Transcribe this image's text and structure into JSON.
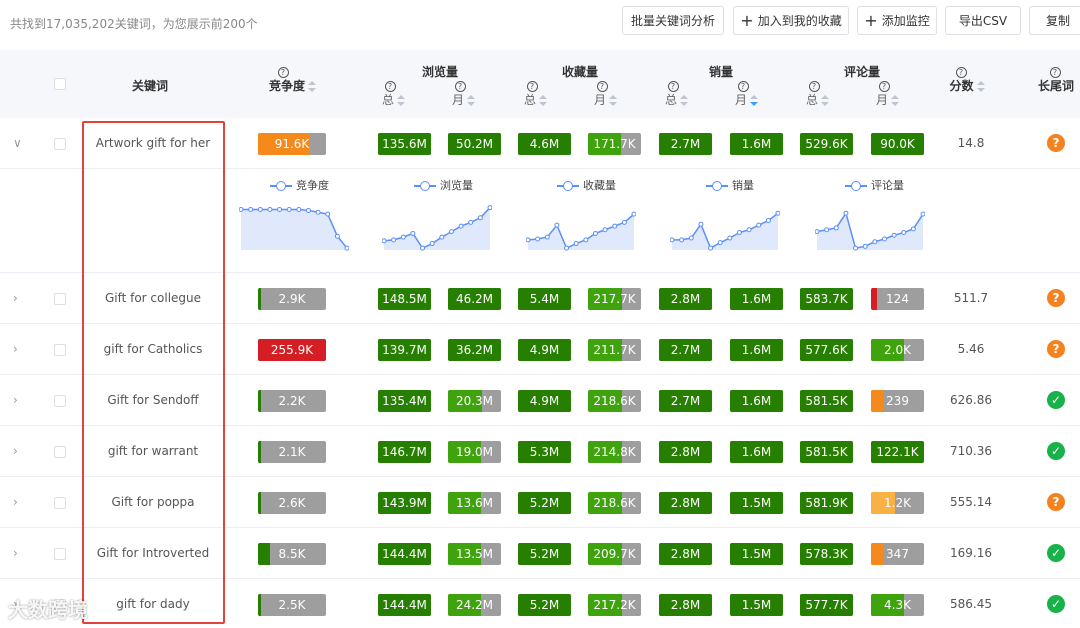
{
  "topbar": {
    "result_text": "共找到17,035,202关键词，为您展示前200个",
    "buttons": [
      "批量关键词分析",
      "加入到我的收藏",
      "添加监控",
      "导出CSV",
      "复制"
    ]
  },
  "header": {
    "keyword": "关键词",
    "competition": "竞争度",
    "views": "浏览量",
    "favorites": "收藏量",
    "sales": "销量",
    "reviews": "评论量",
    "score": "分数",
    "longtail": "长尾词",
    "total": "总",
    "month": "月"
  },
  "colors": {
    "dark_green": "#267f00",
    "mid_green": "#3fa30e",
    "orange": "#f5891b",
    "light_orange": "#f9b144",
    "red": "#d51e24",
    "grey": "#9e9e9e",
    "chart_line": "#5b8ff9",
    "check_green": "#19b24a",
    "question_orange": "#f5811f"
  },
  "expanded_charts": {
    "legends": [
      "竞争度",
      "浏览量",
      "收藏量",
      "销量",
      "评论量"
    ],
    "series": [
      [
        88,
        88,
        88,
        88,
        88,
        88,
        88,
        86,
        82,
        78,
        30,
        4
      ],
      [
        20,
        22,
        28,
        36,
        4,
        14,
        28,
        40,
        52,
        60,
        70,
        92
      ],
      [
        22,
        24,
        28,
        54,
        4,
        14,
        22,
        36,
        44,
        52,
        60,
        78
      ],
      [
        22,
        22,
        26,
        56,
        4,
        16,
        26,
        38,
        44,
        54,
        64,
        80
      ],
      [
        40,
        44,
        48,
        80,
        4,
        8,
        18,
        24,
        32,
        38,
        46,
        78
      ]
    ]
  },
  "rows": [
    {
      "keyword": "Artwork gift for her",
      "expanded": true,
      "comp": {
        "text": "91.6K",
        "color": "orange",
        "fill": 0.75
      },
      "cells": [
        {
          "text": "135.6M",
          "color": "dark_green",
          "fill": 1
        },
        {
          "text": "50.2M",
          "color": "dark_green",
          "fill": 1
        },
        {
          "text": "4.6M",
          "color": "dark_green",
          "fill": 1
        },
        {
          "text": "171.7K",
          "color": "mid_green",
          "fill": 0.62
        },
        {
          "text": "2.7M",
          "color": "dark_green",
          "fill": 1
        },
        {
          "text": "1.6M",
          "color": "dark_green",
          "fill": 1
        },
        {
          "text": "529.6K",
          "color": "dark_green",
          "fill": 1
        },
        {
          "text": "90.0K",
          "color": "dark_green",
          "fill": 1
        }
      ],
      "score": "14.8",
      "longtail": "question"
    },
    {
      "keyword": "Gift for collegue",
      "expanded": false,
      "comp": {
        "text": "2.9K",
        "color": "dark_green",
        "fill": 0.05
      },
      "cells": [
        {
          "text": "148.5M",
          "color": "dark_green",
          "fill": 1
        },
        {
          "text": "46.2M",
          "color": "dark_green",
          "fill": 1
        },
        {
          "text": "5.4M",
          "color": "dark_green",
          "fill": 1
        },
        {
          "text": "217.7K",
          "color": "mid_green",
          "fill": 0.65
        },
        {
          "text": "2.8M",
          "color": "dark_green",
          "fill": 1
        },
        {
          "text": "1.6M",
          "color": "dark_green",
          "fill": 1
        },
        {
          "text": "583.7K",
          "color": "dark_green",
          "fill": 1
        },
        {
          "text": "124",
          "color": "red",
          "fill": 0.12
        }
      ],
      "score": "511.7",
      "longtail": "question"
    },
    {
      "keyword": "gift for Catholics",
      "expanded": false,
      "comp": {
        "text": "255.9K",
        "color": "red",
        "fill": 1
      },
      "cells": [
        {
          "text": "139.7M",
          "color": "dark_green",
          "fill": 1
        },
        {
          "text": "36.2M",
          "color": "dark_green",
          "fill": 1
        },
        {
          "text": "4.9M",
          "color": "dark_green",
          "fill": 1
        },
        {
          "text": "211.7K",
          "color": "mid_green",
          "fill": 0.65
        },
        {
          "text": "2.7M",
          "color": "dark_green",
          "fill": 1
        },
        {
          "text": "1.6M",
          "color": "dark_green",
          "fill": 1
        },
        {
          "text": "577.6K",
          "color": "dark_green",
          "fill": 1
        },
        {
          "text": "2.0K",
          "color": "mid_green",
          "fill": 0.62
        }
      ],
      "score": "5.46",
      "longtail": "question"
    },
    {
      "keyword": "Gift for Sendoff",
      "expanded": false,
      "comp": {
        "text": "2.2K",
        "color": "dark_green",
        "fill": 0.05
      },
      "cells": [
        {
          "text": "135.4M",
          "color": "dark_green",
          "fill": 1
        },
        {
          "text": "20.3M",
          "color": "mid_green",
          "fill": 0.65
        },
        {
          "text": "4.9M",
          "color": "dark_green",
          "fill": 1
        },
        {
          "text": "218.6K",
          "color": "mid_green",
          "fill": 0.65
        },
        {
          "text": "2.7M",
          "color": "dark_green",
          "fill": 1
        },
        {
          "text": "1.6M",
          "color": "dark_green",
          "fill": 1
        },
        {
          "text": "581.5K",
          "color": "dark_green",
          "fill": 1
        },
        {
          "text": "239",
          "color": "orange",
          "fill": 0.22
        }
      ],
      "score": "626.86",
      "longtail": "check"
    },
    {
      "keyword": "gift for warrant",
      "expanded": false,
      "comp": {
        "text": "2.1K",
        "color": "dark_green",
        "fill": 0.05
      },
      "cells": [
        {
          "text": "146.7M",
          "color": "dark_green",
          "fill": 1
        },
        {
          "text": "19.0M",
          "color": "mid_green",
          "fill": 0.62
        },
        {
          "text": "5.3M",
          "color": "dark_green",
          "fill": 1
        },
        {
          "text": "214.8K",
          "color": "mid_green",
          "fill": 0.65
        },
        {
          "text": "2.8M",
          "color": "dark_green",
          "fill": 1
        },
        {
          "text": "1.6M",
          "color": "dark_green",
          "fill": 1
        },
        {
          "text": "581.5K",
          "color": "dark_green",
          "fill": 1
        },
        {
          "text": "122.1K",
          "color": "dark_green",
          "fill": 1
        }
      ],
      "score": "710.36",
      "longtail": "check"
    },
    {
      "keyword": "Gift for poppa",
      "expanded": false,
      "comp": {
        "text": "2.6K",
        "color": "dark_green",
        "fill": 0.05
      },
      "cells": [
        {
          "text": "143.9M",
          "color": "dark_green",
          "fill": 1
        },
        {
          "text": "13.6M",
          "color": "mid_green",
          "fill": 0.62
        },
        {
          "text": "5.2M",
          "color": "dark_green",
          "fill": 1
        },
        {
          "text": "218.6K",
          "color": "mid_green",
          "fill": 0.65
        },
        {
          "text": "2.8M",
          "color": "dark_green",
          "fill": 1
        },
        {
          "text": "1.5M",
          "color": "dark_green",
          "fill": 1
        },
        {
          "text": "581.9K",
          "color": "dark_green",
          "fill": 1
        },
        {
          "text": "1.2K",
          "color": "light_orange",
          "fill": 0.45
        }
      ],
      "score": "555.14",
      "longtail": "question"
    },
    {
      "keyword": "Gift for Introverted",
      "expanded": false,
      "comp": {
        "text": "8.5K",
        "color": "dark_green",
        "fill": 0.17
      },
      "cells": [
        {
          "text": "144.4M",
          "color": "dark_green",
          "fill": 1
        },
        {
          "text": "13.5M",
          "color": "mid_green",
          "fill": 0.62
        },
        {
          "text": "5.2M",
          "color": "dark_green",
          "fill": 1
        },
        {
          "text": "209.7K",
          "color": "mid_green",
          "fill": 0.65
        },
        {
          "text": "2.8M",
          "color": "dark_green",
          "fill": 1
        },
        {
          "text": "1.5M",
          "color": "dark_green",
          "fill": 1
        },
        {
          "text": "578.3K",
          "color": "dark_green",
          "fill": 1
        },
        {
          "text": "347",
          "color": "orange",
          "fill": 0.25
        }
      ],
      "score": "169.16",
      "longtail": "check"
    },
    {
      "keyword": "gift for dady",
      "expanded": false,
      "comp": {
        "text": "2.5K",
        "color": "dark_green",
        "fill": 0.05
      },
      "cells": [
        {
          "text": "144.4M",
          "color": "dark_green",
          "fill": 1
        },
        {
          "text": "24.2M",
          "color": "mid_green",
          "fill": 0.62
        },
        {
          "text": "5.2M",
          "color": "dark_green",
          "fill": 1
        },
        {
          "text": "217.2K",
          "color": "mid_green",
          "fill": 0.65
        },
        {
          "text": "2.8M",
          "color": "dark_green",
          "fill": 1
        },
        {
          "text": "1.5M",
          "color": "dark_green",
          "fill": 1
        },
        {
          "text": "577.7K",
          "color": "dark_green",
          "fill": 1
        },
        {
          "text": "4.3K",
          "color": "mid_green",
          "fill": 0.62
        }
      ],
      "score": "586.45",
      "longtail": "check"
    }
  ],
  "watermark": "大数跨境"
}
